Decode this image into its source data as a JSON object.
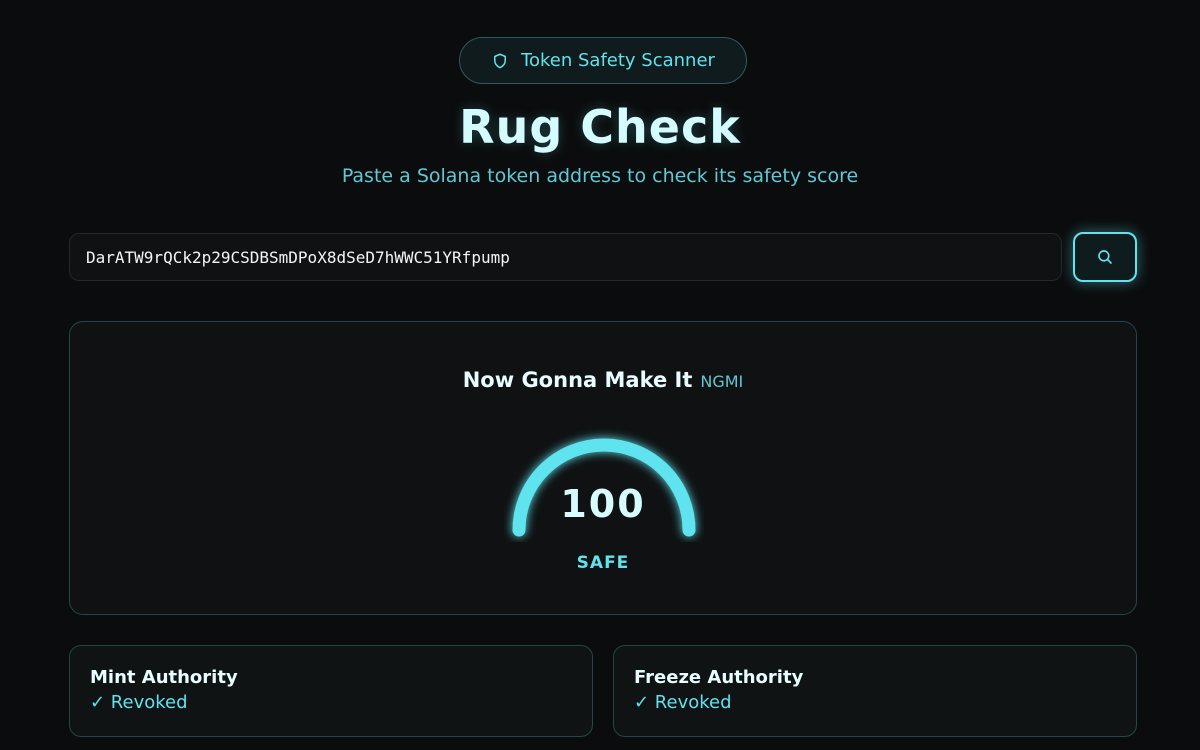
{
  "header": {
    "badge_label": "Token Safety Scanner",
    "badge_icon": "shield-icon",
    "title": "Rug Check",
    "subtitle": "Paste a Solana token address to check its safety score"
  },
  "search": {
    "value": "DarATW9rQCk2p29CSDBSmDPoX8dSeD7hWWC51YRfpump",
    "button_icon": "search-icon"
  },
  "result": {
    "token_name": "Now Gonna Make It",
    "token_symbol": "NGMI",
    "score": "100",
    "score_fraction": 1.0,
    "verdict": "SAFE"
  },
  "checks": [
    {
      "label": "Mint Authority",
      "value": "✓ Revoked"
    },
    {
      "label": "Freeze Authority",
      "value": "✓ Revoked"
    }
  ],
  "colors": {
    "accent": "#5fe3ee",
    "background": "#0b0c0d",
    "card": "#0f1112"
  }
}
